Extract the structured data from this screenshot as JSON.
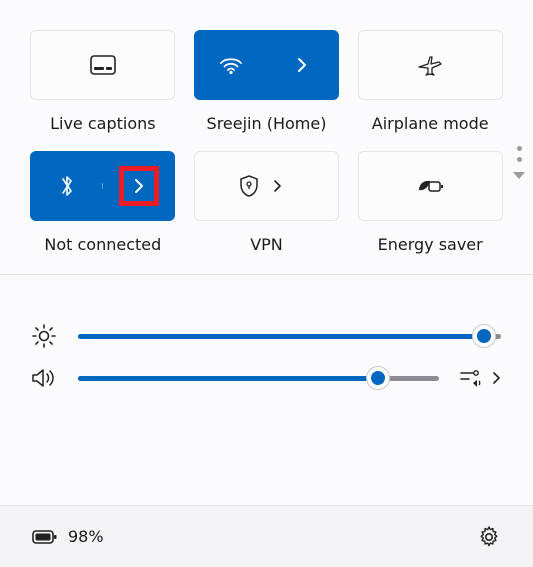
{
  "tiles": [
    {
      "label": "Live captions"
    },
    {
      "label": "Sreejin (Home)"
    },
    {
      "label": "Airplane mode"
    },
    {
      "label": "Not connected"
    },
    {
      "label": "VPN"
    },
    {
      "label": "Energy saver"
    }
  ],
  "sliders": {
    "brightness": {
      "value": 96
    },
    "volume": {
      "value": 83
    }
  },
  "battery": {
    "text": "98%"
  },
  "colors": {
    "accent": "#0067c0",
    "highlight": "#ee1c25"
  }
}
